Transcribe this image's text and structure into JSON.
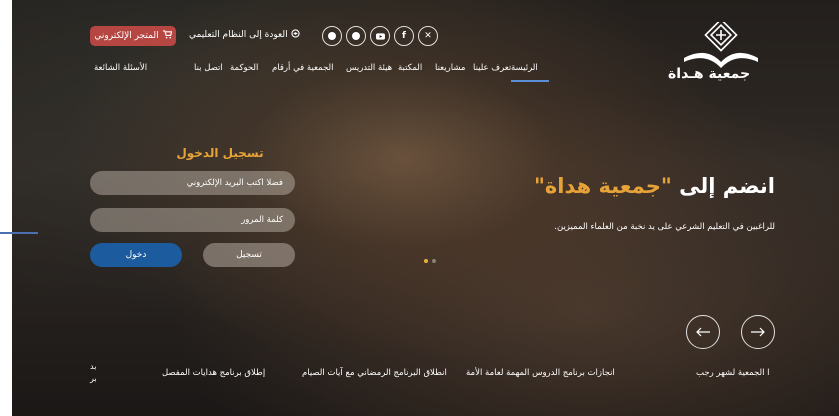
{
  "header": {
    "store_button": "المتجر الإلكتروني",
    "back_link": "العودة إلى النظام التعليمي",
    "logo_text": "جمعية هـداة",
    "socials": [
      "whatsapp-icon",
      "telegram-icon",
      "youtube-icon",
      "facebook-icon",
      "x-icon"
    ]
  },
  "nav": {
    "items": [
      "الرئيسة",
      "تعرف علينا",
      "مشاريعنا",
      "المكتبة",
      "هيئة التدريس",
      "الجمعية في أرقام",
      "الحوكمة",
      "اتصل بنا",
      "الأسئلة الشائعة"
    ],
    "active_index": 0
  },
  "login": {
    "title": "تسجيل الدخول",
    "email_placeholder": "فضلا اكتب البريد الإلكتروني",
    "password_placeholder": "كلمة المرور",
    "register_label": "تسجيل",
    "login_label": "دخول"
  },
  "hero": {
    "title_prefix": "انضم إلى",
    "title_accent": "\"جمعية هداة\"",
    "subtitle": "للراغبين في التعليم الشرعي على يد نخبة من العلماء المميزين."
  },
  "news": {
    "items": [
      "ا الجمعية لشهر رجب",
      "انجازات برنامج الدروس المهمة لعامة الأمة",
      "انطلاق البرنامج الرمضاني مع آيات الصيام",
      "إطلاق برنامج هدايات المفصل"
    ],
    "fragment_1": "بد",
    "fragment_2": "بر"
  },
  "colors": {
    "accent": "#e7a338",
    "primary": "#1c5b9e",
    "store": "#b64642"
  }
}
